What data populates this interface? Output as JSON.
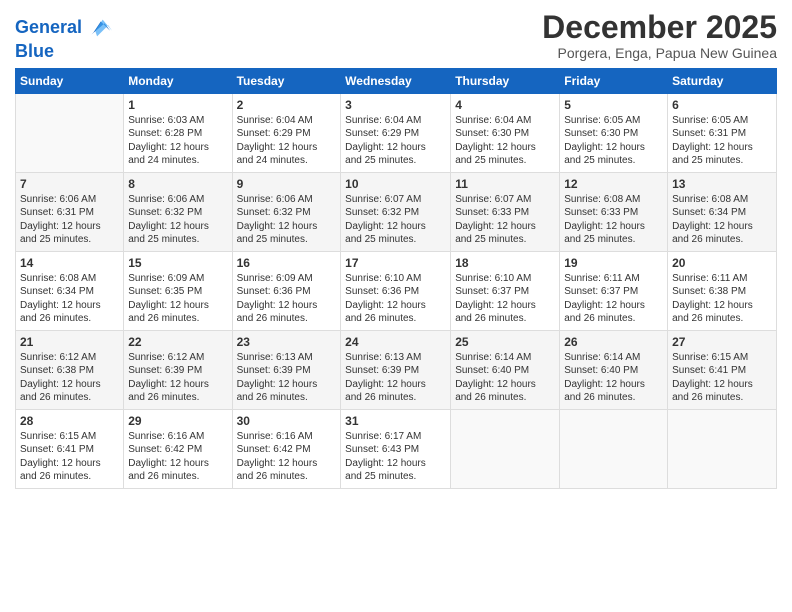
{
  "header": {
    "logo_line1": "General",
    "logo_line2": "Blue",
    "month_year": "December 2025",
    "location": "Porgera, Enga, Papua New Guinea"
  },
  "weekdays": [
    "Sunday",
    "Monday",
    "Tuesday",
    "Wednesday",
    "Thursday",
    "Friday",
    "Saturday"
  ],
  "weeks": [
    [
      {
        "day": "",
        "info": ""
      },
      {
        "day": "1",
        "info": "Sunrise: 6:03 AM\nSunset: 6:28 PM\nDaylight: 12 hours\nand 24 minutes."
      },
      {
        "day": "2",
        "info": "Sunrise: 6:04 AM\nSunset: 6:29 PM\nDaylight: 12 hours\nand 24 minutes."
      },
      {
        "day": "3",
        "info": "Sunrise: 6:04 AM\nSunset: 6:29 PM\nDaylight: 12 hours\nand 25 minutes."
      },
      {
        "day": "4",
        "info": "Sunrise: 6:04 AM\nSunset: 6:30 PM\nDaylight: 12 hours\nand 25 minutes."
      },
      {
        "day": "5",
        "info": "Sunrise: 6:05 AM\nSunset: 6:30 PM\nDaylight: 12 hours\nand 25 minutes."
      },
      {
        "day": "6",
        "info": "Sunrise: 6:05 AM\nSunset: 6:31 PM\nDaylight: 12 hours\nand 25 minutes."
      }
    ],
    [
      {
        "day": "7",
        "info": "Sunrise: 6:06 AM\nSunset: 6:31 PM\nDaylight: 12 hours\nand 25 minutes."
      },
      {
        "day": "8",
        "info": "Sunrise: 6:06 AM\nSunset: 6:32 PM\nDaylight: 12 hours\nand 25 minutes."
      },
      {
        "day": "9",
        "info": "Sunrise: 6:06 AM\nSunset: 6:32 PM\nDaylight: 12 hours\nand 25 minutes."
      },
      {
        "day": "10",
        "info": "Sunrise: 6:07 AM\nSunset: 6:32 PM\nDaylight: 12 hours\nand 25 minutes."
      },
      {
        "day": "11",
        "info": "Sunrise: 6:07 AM\nSunset: 6:33 PM\nDaylight: 12 hours\nand 25 minutes."
      },
      {
        "day": "12",
        "info": "Sunrise: 6:08 AM\nSunset: 6:33 PM\nDaylight: 12 hours\nand 25 minutes."
      },
      {
        "day": "13",
        "info": "Sunrise: 6:08 AM\nSunset: 6:34 PM\nDaylight: 12 hours\nand 26 minutes."
      }
    ],
    [
      {
        "day": "14",
        "info": "Sunrise: 6:08 AM\nSunset: 6:34 PM\nDaylight: 12 hours\nand 26 minutes."
      },
      {
        "day": "15",
        "info": "Sunrise: 6:09 AM\nSunset: 6:35 PM\nDaylight: 12 hours\nand 26 minutes."
      },
      {
        "day": "16",
        "info": "Sunrise: 6:09 AM\nSunset: 6:36 PM\nDaylight: 12 hours\nand 26 minutes."
      },
      {
        "day": "17",
        "info": "Sunrise: 6:10 AM\nSunset: 6:36 PM\nDaylight: 12 hours\nand 26 minutes."
      },
      {
        "day": "18",
        "info": "Sunrise: 6:10 AM\nSunset: 6:37 PM\nDaylight: 12 hours\nand 26 minutes."
      },
      {
        "day": "19",
        "info": "Sunrise: 6:11 AM\nSunset: 6:37 PM\nDaylight: 12 hours\nand 26 minutes."
      },
      {
        "day": "20",
        "info": "Sunrise: 6:11 AM\nSunset: 6:38 PM\nDaylight: 12 hours\nand 26 minutes."
      }
    ],
    [
      {
        "day": "21",
        "info": "Sunrise: 6:12 AM\nSunset: 6:38 PM\nDaylight: 12 hours\nand 26 minutes."
      },
      {
        "day": "22",
        "info": "Sunrise: 6:12 AM\nSunset: 6:39 PM\nDaylight: 12 hours\nand 26 minutes."
      },
      {
        "day": "23",
        "info": "Sunrise: 6:13 AM\nSunset: 6:39 PM\nDaylight: 12 hours\nand 26 minutes."
      },
      {
        "day": "24",
        "info": "Sunrise: 6:13 AM\nSunset: 6:39 PM\nDaylight: 12 hours\nand 26 minutes."
      },
      {
        "day": "25",
        "info": "Sunrise: 6:14 AM\nSunset: 6:40 PM\nDaylight: 12 hours\nand 26 minutes."
      },
      {
        "day": "26",
        "info": "Sunrise: 6:14 AM\nSunset: 6:40 PM\nDaylight: 12 hours\nand 26 minutes."
      },
      {
        "day": "27",
        "info": "Sunrise: 6:15 AM\nSunset: 6:41 PM\nDaylight: 12 hours\nand 26 minutes."
      }
    ],
    [
      {
        "day": "28",
        "info": "Sunrise: 6:15 AM\nSunset: 6:41 PM\nDaylight: 12 hours\nand 26 minutes."
      },
      {
        "day": "29",
        "info": "Sunrise: 6:16 AM\nSunset: 6:42 PM\nDaylight: 12 hours\nand 26 minutes."
      },
      {
        "day": "30",
        "info": "Sunrise: 6:16 AM\nSunset: 6:42 PM\nDaylight: 12 hours\nand 26 minutes."
      },
      {
        "day": "31",
        "info": "Sunrise: 6:17 AM\nSunset: 6:43 PM\nDaylight: 12 hours\nand 25 minutes."
      },
      {
        "day": "",
        "info": ""
      },
      {
        "day": "",
        "info": ""
      },
      {
        "day": "",
        "info": ""
      }
    ]
  ]
}
